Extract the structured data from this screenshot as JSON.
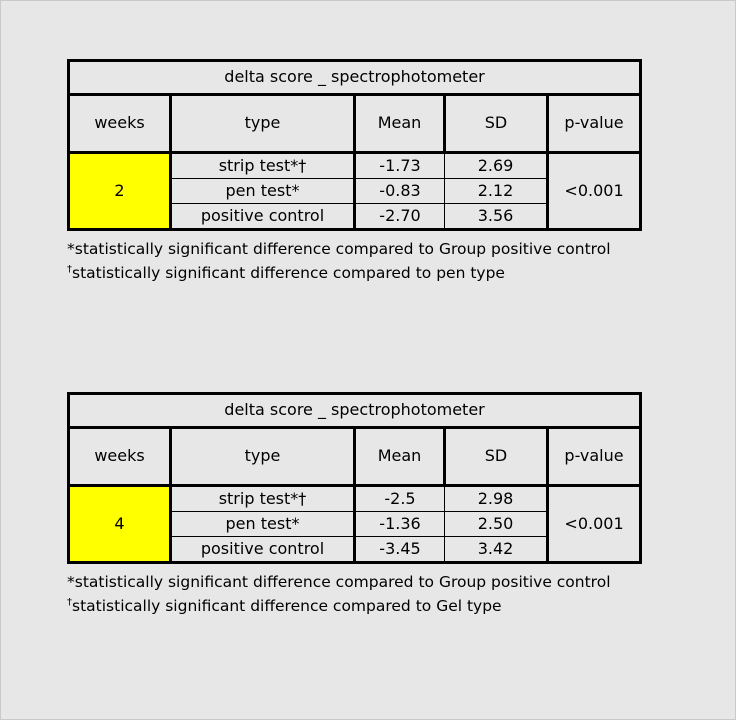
{
  "page": {
    "background_color": "#e7e7e7",
    "border_color": "#c9c9c9",
    "highlight_color": "#ffff00"
  },
  "tables": [
    {
      "title": "delta score _ spectrophotometer",
      "columns": [
        "weeks",
        "type",
        "Mean",
        "SD",
        "p-value"
      ],
      "weeks": "2",
      "p_value": "<0.001",
      "rows": [
        {
          "type": "strip test*†",
          "mean": "-1.73",
          "sd": "2.69"
        },
        {
          "type": "pen test*",
          "mean": "-0.83",
          "sd": "2.12"
        },
        {
          "type": "positive control",
          "mean": "-2.70",
          "sd": "3.56"
        }
      ],
      "footnotes": [
        {
          "marker": "*",
          "text": "statistically significant difference compared to Group positive control"
        },
        {
          "marker": "†",
          "text": "statistically significant difference compared to pen type"
        }
      ]
    },
    {
      "title": "delta score _ spectrophotometer",
      "columns": [
        "weeks",
        "type",
        "Mean",
        "SD",
        "p-value"
      ],
      "weeks": "4",
      "p_value": "<0.001",
      "rows": [
        {
          "type": "strip test*†",
          "mean": "-2.5",
          "sd": "2.98"
        },
        {
          "type": "pen test*",
          "mean": "-1.36",
          "sd": "2.50"
        },
        {
          "type": "positive control",
          "mean": "-3.45",
          "sd": "3.42"
        }
      ],
      "footnotes": [
        {
          "marker": "*",
          "text": "statistically significant difference compared to Group positive control"
        },
        {
          "marker": "†",
          "text": "statistically significant difference compared to Gel type"
        }
      ]
    }
  ]
}
